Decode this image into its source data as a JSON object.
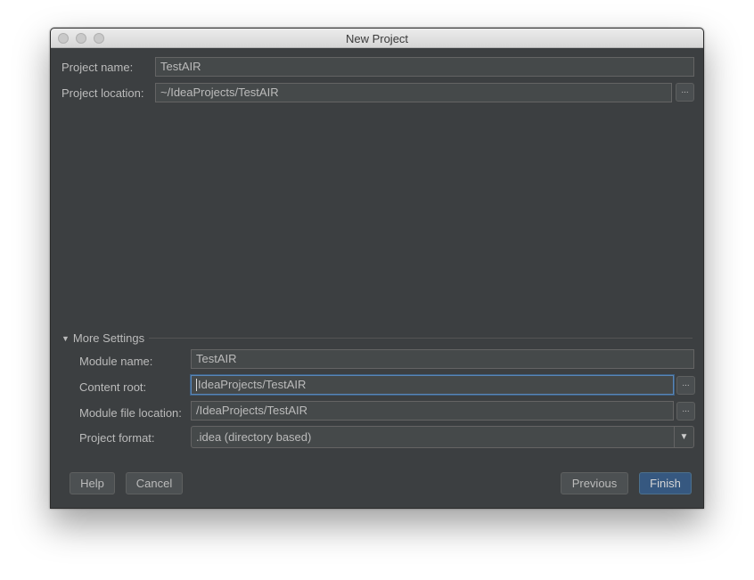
{
  "window": {
    "title": "New Project"
  },
  "project": {
    "name_label": "Project name:",
    "name_value": "TestAIR",
    "location_label": "Project location:",
    "location_value": "~/IdeaProjects/TestAIR",
    "browse_label": "..."
  },
  "more_settings": {
    "toggle_label": "More Settings",
    "module_name_label": "Module name:",
    "module_name_value": "TestAIR",
    "content_root_label": "Content root:",
    "content_root_value": "IdeaProjects/TestAIR",
    "module_file_label": "Module file location:",
    "module_file_value": "/IdeaProjects/TestAIR",
    "project_format_label": "Project format:",
    "project_format_value": ".idea (directory based)",
    "browse_label": "..."
  },
  "buttons": {
    "help": "Help",
    "cancel": "Cancel",
    "previous": "Previous",
    "finish": "Finish"
  }
}
